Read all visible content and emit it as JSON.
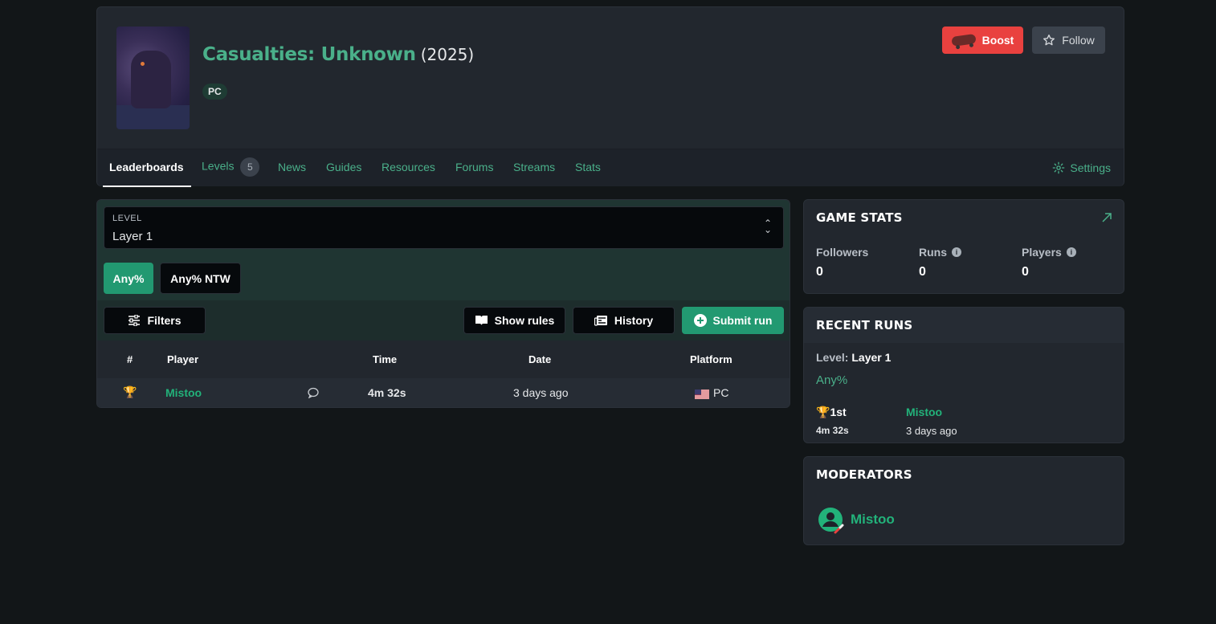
{
  "game": {
    "title": "Casualties: Unknown",
    "year": "(2025)",
    "platform_badge": "PC"
  },
  "actions": {
    "boost_label": "Boost",
    "follow_label": "Follow"
  },
  "nav": {
    "leaderboards": "Leaderboards",
    "levels": "Levels",
    "levels_count": "5",
    "news": "News",
    "guides": "Guides",
    "resources": "Resources",
    "forums": "Forums",
    "streams": "Streams",
    "stats": "Stats",
    "settings": "Settings"
  },
  "leaderboard": {
    "level_label": "LEVEL",
    "level_value": "Layer 1",
    "categories": [
      "Any%",
      "Any% NTW"
    ],
    "filters_label": "Filters",
    "show_rules_label": "Show rules",
    "history_label": "History",
    "submit_run_label": "Submit run",
    "columns": [
      "#",
      "Player",
      "Time",
      "Date",
      "Platform"
    ],
    "rows": [
      {
        "rank_icon": "trophy-icon",
        "player": "Mistoo",
        "time": "4m 32s",
        "date": "3 days ago",
        "platform": "PC",
        "flag": "us-flag-icon"
      }
    ]
  },
  "game_stats": {
    "title": "GAME STATS",
    "followers_label": "Followers",
    "followers_value": "0",
    "runs_label": "Runs",
    "runs_value": "0",
    "players_label": "Players",
    "players_value": "0"
  },
  "recent_runs": {
    "title": "RECENT RUNS",
    "level_prefix": "Level:",
    "level_name": "Layer 1",
    "category": "Any%",
    "place": "1st",
    "time": "4m 32s",
    "player": "Mistoo",
    "date": "3 days ago"
  },
  "moderators": {
    "title": "MODERATORS",
    "names": [
      "Mistoo"
    ]
  },
  "colors": {
    "accent_green": "#4ab08a",
    "button_green": "#229971",
    "boost_red": "#e9413f",
    "background": "#121618",
    "card": "#22272e"
  }
}
